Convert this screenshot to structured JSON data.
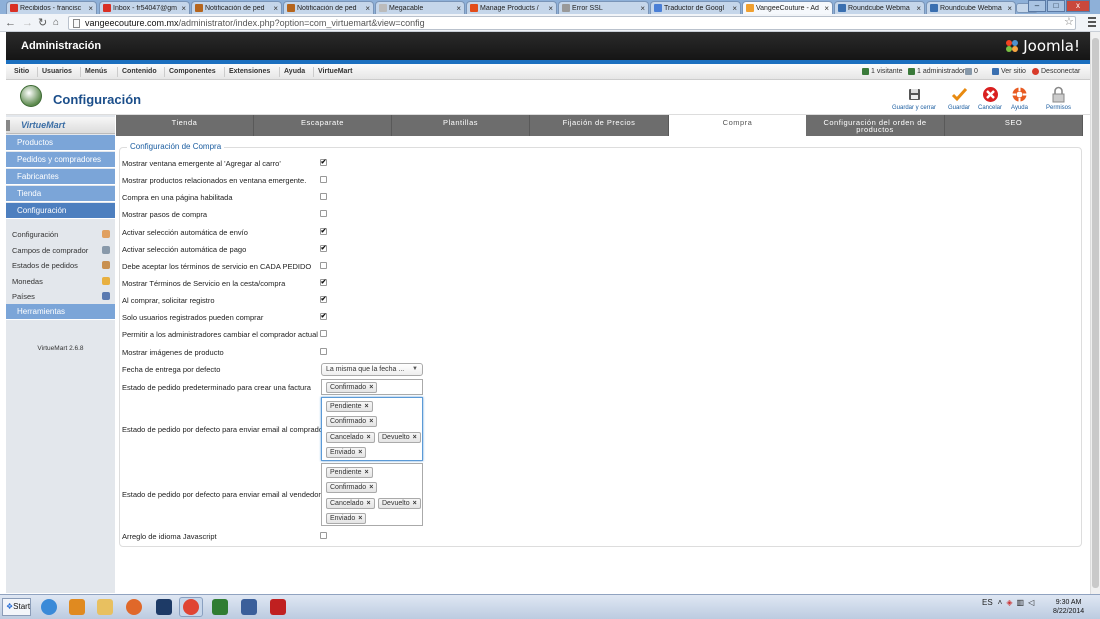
{
  "browser": {
    "tabs": [
      {
        "label": "Recibidos - francisc",
        "icon_color": "#d93025",
        "icon": "gmail-icon"
      },
      {
        "label": "Inbox - fr54047@gm",
        "icon_color": "#d93025",
        "icon": "gmail-icon"
      },
      {
        "label": "Notificación de ped",
        "icon_color": "#b5651d",
        "icon": "site-icon"
      },
      {
        "label": "Notificación de ped",
        "icon_color": "#b5651d",
        "icon": "site-icon"
      },
      {
        "label": "Megacable",
        "icon_color": "#bbbbbb",
        "icon": "page-icon"
      },
      {
        "label": "Manage Products /",
        "icon_color": "#e24c1a",
        "icon": "site-icon"
      },
      {
        "label": "Error SSL",
        "icon_color": "#999999",
        "icon": "page-icon"
      },
      {
        "label": "Traductor de Googl",
        "icon_color": "#4a7fd6",
        "icon": "translate-icon"
      },
      {
        "label": "VangeeCouture - Ad",
        "icon_color": "#f0a030",
        "icon": "joomla-icon"
      },
      {
        "label": "Roundcube Webma",
        "icon_color": "#3a6fb0",
        "icon": "roundcube-icon"
      },
      {
        "label": "Roundcube Webma",
        "icon_color": "#3a6fb0",
        "icon": "roundcube-icon"
      }
    ],
    "active_tab": 8,
    "url_host": "vangeecouture.com.mx",
    "url_path": "/administrator/index.php?option=com_virtuemart&view=config",
    "win_min": "–",
    "win_max": "□",
    "win_close": "x"
  },
  "header": {
    "title": "Administración",
    "logo_text": "Joomla!"
  },
  "topmenu": {
    "items": [
      "Sitio",
      "Usuarios",
      "Menús",
      "Contenido",
      "Componentes",
      "Extensiones",
      "Ayuda",
      "VirtueMart"
    ],
    "status": [
      {
        "label": "1 visitante",
        "color": "#3a7a3a"
      },
      {
        "label": "1 administrador",
        "color": "#3a7a3a"
      },
      {
        "label": "0",
        "color": "#8899aa"
      },
      {
        "label": "Ver sitio",
        "color": "#3a6fb0"
      },
      {
        "label": "Desconectar",
        "color": "#d83a2a"
      }
    ]
  },
  "toolbar": {
    "title": "Configuración",
    "buttons": [
      {
        "label": "Guardar y cerrar",
        "icon": "save-close-icon"
      },
      {
        "label": "Guardar",
        "icon": "checkmark-icon"
      },
      {
        "label": "Cancelar",
        "icon": "cancel-icon"
      },
      {
        "label": "Ayuda",
        "icon": "help-icon"
      },
      {
        "label": "Permisos",
        "icon": "lock-icon"
      }
    ]
  },
  "sidebar": {
    "logo": "VirtueMart",
    "groups_top": [
      "Productos",
      "Pedidos y compradores",
      "Fabricantes",
      "Tienda",
      "Configuración"
    ],
    "active_group": "Configuración",
    "subitems": [
      {
        "label": "Configuración",
        "color": "#e0a060"
      },
      {
        "label": "Campos de comprador",
        "color": "#8899aa"
      },
      {
        "label": "Estados de pedidos",
        "color": "#c89050"
      },
      {
        "label": "Monedas",
        "color": "#e8b040"
      },
      {
        "label": "Países",
        "color": "#5a7ab0"
      }
    ],
    "group_bottom": "Herramientas",
    "version": "VirtueMart 2.6.8"
  },
  "tabs": {
    "items": [
      "Tienda",
      "Escaparate",
      "Plantillas",
      "Fijación de Precios",
      "Compra",
      "Configuración del orden de productos",
      "SEO"
    ],
    "active": "Compra"
  },
  "form": {
    "legend": "Configuración de Compra",
    "checkbox_rows": [
      {
        "label": "Mostrar ventana emergente al 'Agregar al carro'",
        "checked": true
      },
      {
        "label": "Mostrar productos relacionados en ventana emergente.",
        "checked": false
      },
      {
        "label": "Compra en una página habilitada",
        "checked": false
      },
      {
        "label": "Mostrar pasos de compra",
        "checked": false
      },
      {
        "label": "Activar selección automática de envío",
        "checked": true
      },
      {
        "label": "Activar selección automática de pago",
        "checked": true
      },
      {
        "label": "Debe aceptar los términos de servicio en CADA PEDIDO",
        "checked": false
      },
      {
        "label": "Mostrar Términos de Servicio en la cesta/compra",
        "checked": true
      },
      {
        "label": "Al comprar, solicitar registro",
        "checked": true
      },
      {
        "label": "Solo usuarios registrados pueden comprar",
        "checked": true
      },
      {
        "label": "Permitir a los administradores cambiar el comprador actual",
        "checked": false
      },
      {
        "label": "Mostrar imágenes de producto",
        "checked": false
      }
    ],
    "delivery_label": "Fecha de entrega por defecto",
    "delivery_value": "La misma que la fecha ...",
    "invoice_label": "Estado de pedido predeterminado para crear una factura",
    "invoice_chips": [
      "Confirmado"
    ],
    "email_buyer_label": "Estado de pedido por defecto para enviar email al comprador",
    "email_buyer_chips": [
      "Pendiente",
      "Confirmado",
      "Cancelado",
      "Devuelto",
      "Enviado"
    ],
    "email_vendor_label": "Estado de pedido por defecto para enviar email al vendedor",
    "email_vendor_chips": [
      "Pendiente",
      "Confirmado",
      "Cancelado",
      "Devuelto",
      "Enviado"
    ],
    "js_label": "Arreglo de idioma Javascript",
    "js_checked": false,
    "chip_remove": "×",
    "check_mark": "✔"
  },
  "taskbar": {
    "start": "Start",
    "lang": "ES",
    "time": "9:30 AM",
    "date": "8/22/2014",
    "apps": [
      {
        "name": "ie-icon",
        "color": "#3a8ad8"
      },
      {
        "name": "outlook-icon",
        "color": "#e08a20"
      },
      {
        "name": "explorer-icon",
        "color": "#e8c060"
      },
      {
        "name": "firefox-icon",
        "color": "#e0682a"
      },
      {
        "name": "photoshop-icon",
        "color": "#1d3a66"
      },
      {
        "name": "chrome-icon",
        "color": "#e04433"
      },
      {
        "name": "excel-icon",
        "color": "#2f7d32"
      },
      {
        "name": "window-icon",
        "color": "#3b5f9a"
      },
      {
        "name": "filezilla-icon",
        "color": "#c02020"
      }
    ]
  }
}
